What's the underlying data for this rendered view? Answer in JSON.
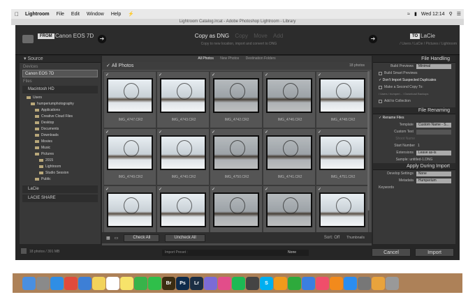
{
  "menubar": {
    "app": "Lightroom",
    "items": [
      "File",
      "Edit",
      "Window",
      "Help"
    ],
    "clock": "Wed 12:14"
  },
  "window_title": "Lightroom Catalog.lrcat - Adobe Photoshop Lightroom - Library",
  "top": {
    "from_badge": "FROM",
    "from_device": "Canon EOS 7D",
    "modes": [
      "Copy as DNG",
      "Copy",
      "Move",
      "Add"
    ],
    "modes_sub": "Copy to new location, import and convert to DNG",
    "to_badge": "TO",
    "to_device": "LaCie",
    "to_sub": "/ Users / LaCie / Pictures / Lightroom"
  },
  "source": {
    "header": "Source",
    "devices_label": "Devices",
    "device": "Canon EOS 7D",
    "files_label": "Files",
    "volume": "Macintosh HD",
    "tree": [
      {
        "label": "Users",
        "indent": 1
      },
      {
        "label": "humperiumphotography",
        "indent": 2
      },
      {
        "label": "Applications",
        "indent": 3
      },
      {
        "label": "Creative Cloud Files",
        "indent": 3
      },
      {
        "label": "Desktop",
        "indent": 3
      },
      {
        "label": "Documents",
        "indent": 3
      },
      {
        "label": "Downloads",
        "indent": 3
      },
      {
        "label": "Movies",
        "indent": 3
      },
      {
        "label": "Music",
        "indent": 3
      },
      {
        "label": "Pictures",
        "indent": 3
      },
      {
        "label": "2015",
        "indent": 4
      },
      {
        "label": "Lightroom",
        "indent": 4
      },
      {
        "label": "Studio Session",
        "indent": 4
      },
      {
        "label": "Public",
        "indent": 3
      }
    ],
    "volume2": "LaCie",
    "volume3": "LACIE SHARE"
  },
  "center": {
    "subtabs": [
      "All Photos",
      "New Photos",
      "Destination Folders"
    ],
    "grid_header": "All Photos",
    "photo_count": "18 photos",
    "photos": [
      "IMG_4747.CR2",
      "IMG_4743.CR2",
      "IMG_4742.CR2",
      "IMG_4746.CR2",
      "IMG_4748.CR2",
      "IMG_4749.CR2",
      "IMG_4740.CR2",
      "IMG_4750.CR2",
      "IMG_4741.CR2",
      "IMG_4751.CR2",
      "",
      "",
      "",
      "",
      ""
    ],
    "check_all": "Check All",
    "uncheck_all": "Uncheck All",
    "sort_label": "Sort:",
    "sort_value": "Off",
    "thumbnails_label": "Thumbnails"
  },
  "right": {
    "file_handling": "File Handling",
    "build_previews_label": "Build Previews",
    "build_previews_value": "Minimal",
    "build_smart": "Build Smart Previews",
    "dont_import": "Don't Import Suspected Duplicates",
    "second_copy": "Make a Second Copy To:",
    "second_copy_path": "/ Users / humperi... / Download Backups",
    "add_collection": "Add to Collection",
    "file_renaming": "File Renaming",
    "rename_files": "Rename Files",
    "template_label": "Template",
    "template_value": "Custom Name - S...",
    "custom_text_label": "Custom Text",
    "shoot_name_label": "Shoot Name",
    "start_number_label": "Start Number",
    "start_number_value": "1",
    "extensions_label": "Extensions",
    "extensions_value": "Leave as-is",
    "sample": "Sample: untitled-1.DNG",
    "apply_during": "Apply During Import",
    "develop_label": "Develop Settings",
    "develop_value": "None",
    "metadata_label": "Metadata",
    "metadata_value": "Humperium",
    "keywords_label": "Keywords"
  },
  "bottom": {
    "photos": "18 photos / 391 MB",
    "import_preset_label": "Import Preset :",
    "import_preset_value": "None",
    "cancel": "Cancel",
    "import": "Import"
  },
  "dock": [
    "Finder",
    "Launchpad",
    "Safari",
    "Chrome",
    "Mail",
    "Notes",
    "Calendar",
    "Stickies",
    "Messages",
    "FaceTime",
    "Bridge",
    "Photoshop",
    "Lightroom",
    "Preview",
    "iTunes",
    "Spotify",
    "Camera",
    "Skype",
    "Pages",
    "Numbers",
    "Keynote",
    "Music",
    "Books",
    "App Store",
    "System Preferences",
    "Photos",
    "Trash"
  ]
}
